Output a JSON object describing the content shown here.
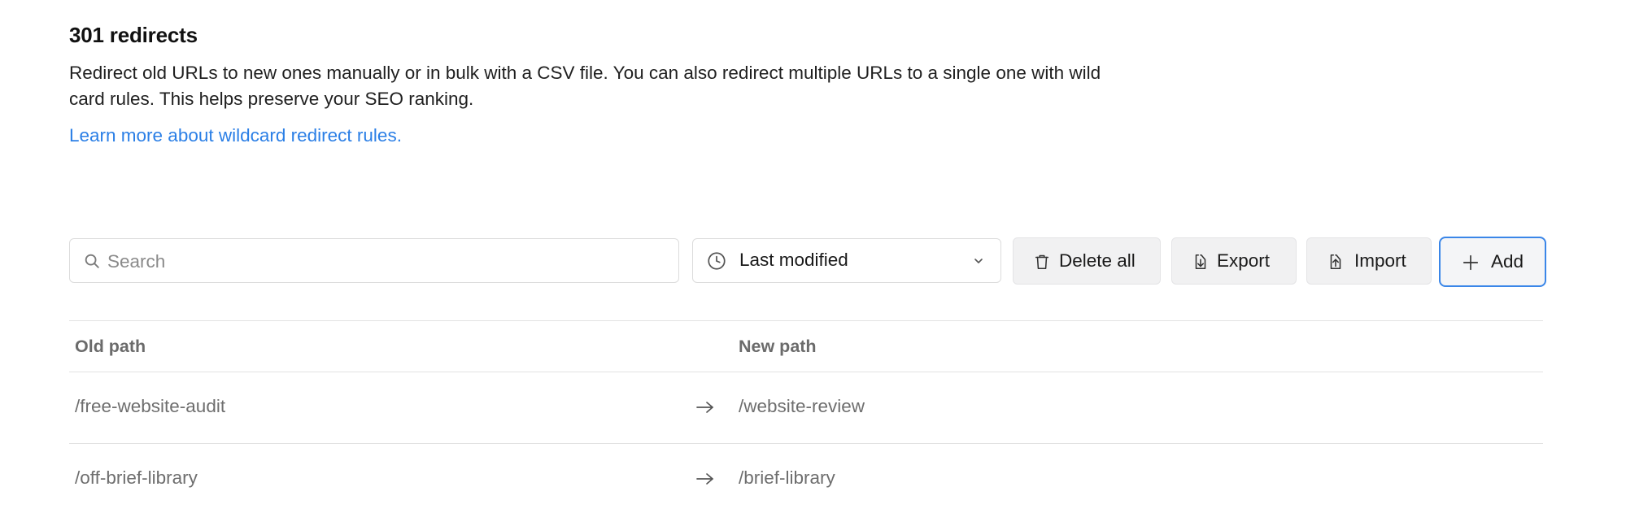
{
  "section": {
    "title": "301 redirects",
    "description": "Redirect old URLs to new ones manually or in bulk with a CSV file. You can also redirect multiple URLs to a single one with wild card rules. This helps preserve your SEO ranking.",
    "learn_more": "Learn more about wildcard redirect rules."
  },
  "toolbar": {
    "search_placeholder": "Search",
    "sort_value": "Last modified",
    "delete_all": "Delete all",
    "export": "Export",
    "import": "Import",
    "add": "Add"
  },
  "table": {
    "columns": {
      "old": "Old path",
      "new": "New path"
    },
    "rows": [
      {
        "old": "/free-website-audit",
        "new": "/website-review"
      },
      {
        "old": "/off-brief-library",
        "new": "/brief-library"
      }
    ]
  },
  "colors": {
    "link": "#2b7fe6",
    "accent_border": "#3a86e8"
  },
  "icons": {
    "search": "search-icon",
    "sort": "clock-icon",
    "dropdown": "chevron-down-icon",
    "delete": "trash-icon",
    "export": "export-icon",
    "import": "import-icon",
    "add": "plus-icon",
    "row_arrow": "arrow-right-icon"
  }
}
